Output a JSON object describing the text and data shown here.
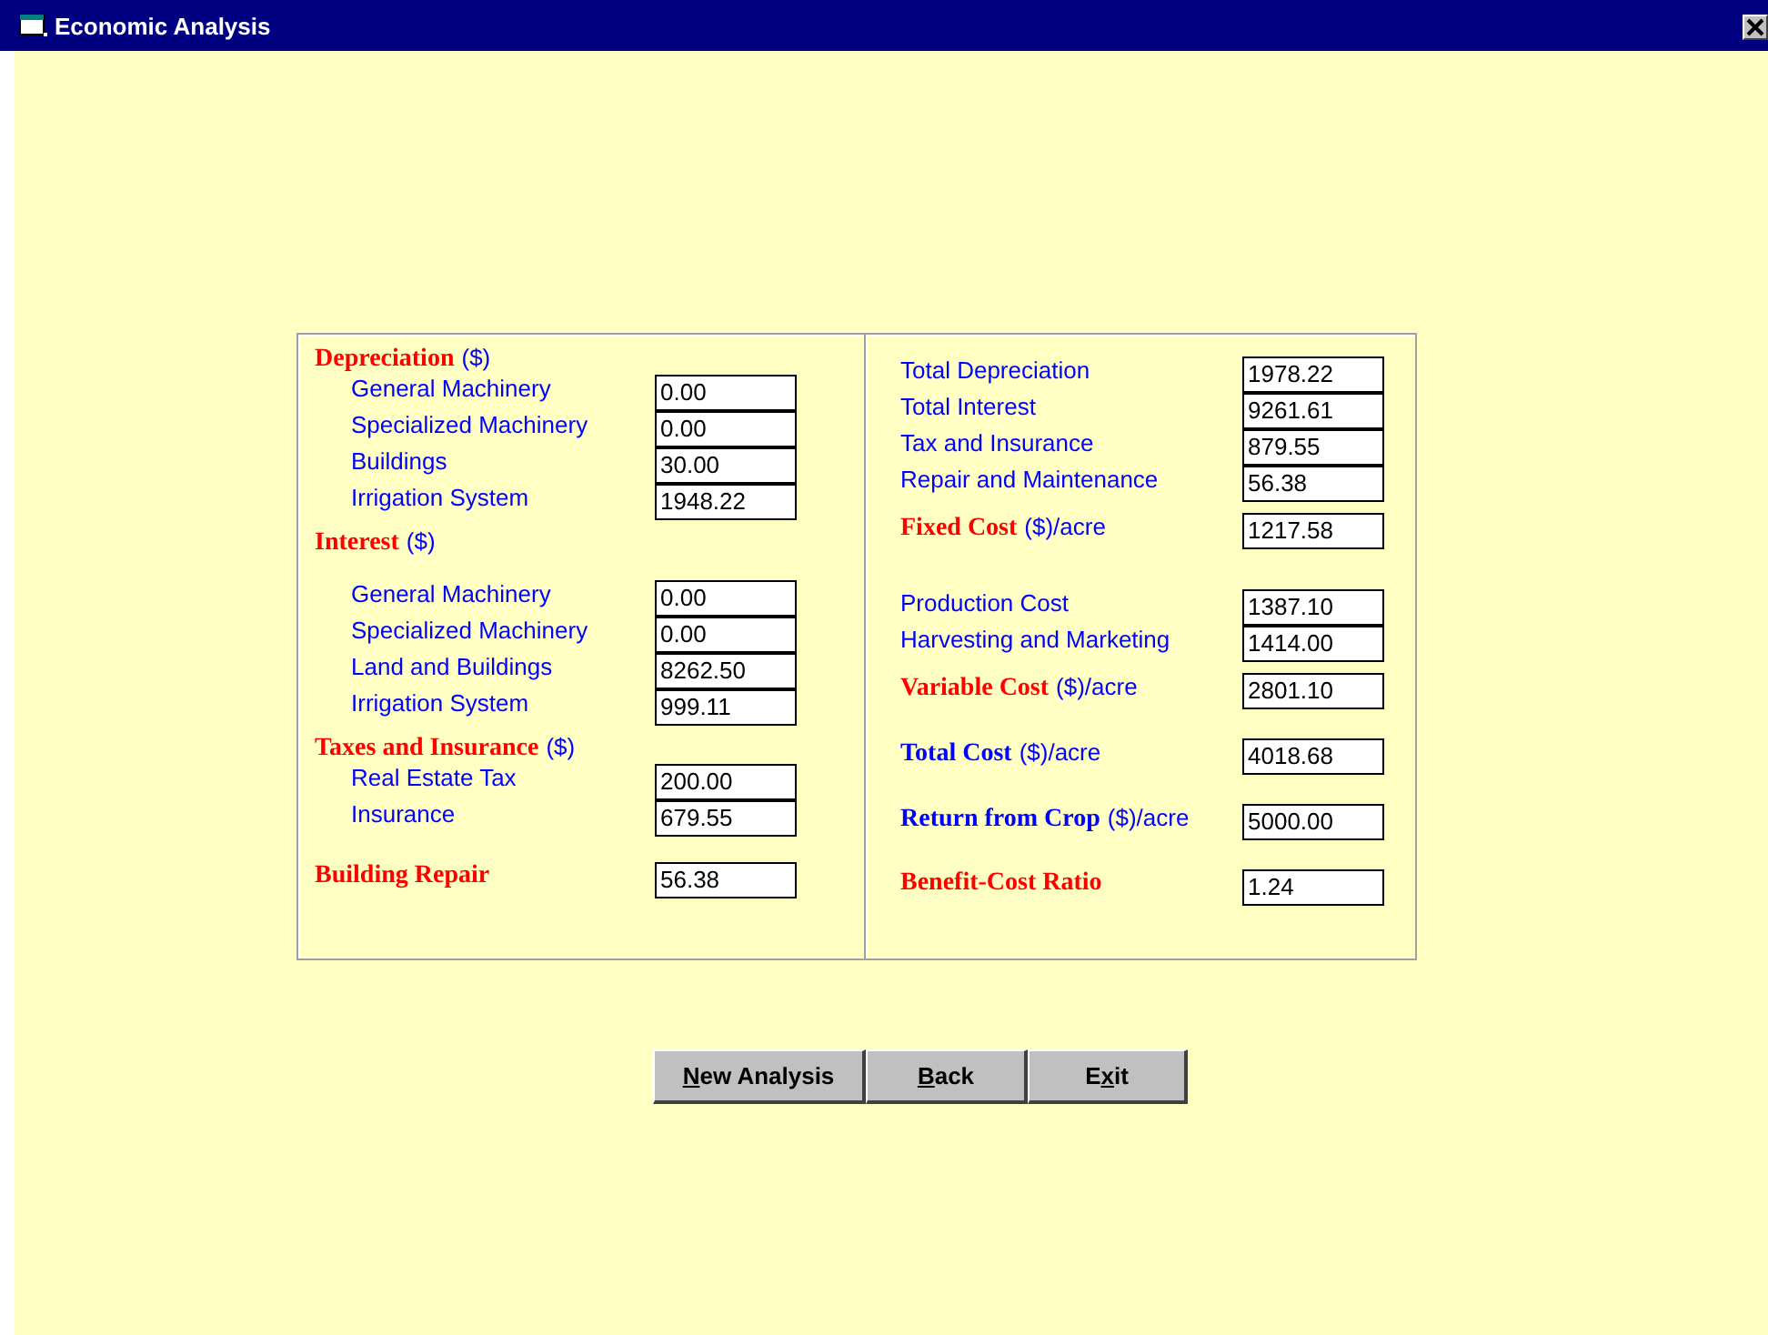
{
  "window": {
    "title": "Economic Analysis"
  },
  "left_panel": {
    "sections": [
      {
        "heading": "Depreciation",
        "unit": "($)",
        "items": [
          {
            "label": "General Machinery",
            "value": "0.00"
          },
          {
            "label": "Specialized Machinery",
            "value": "0.00"
          },
          {
            "label": "Buildings",
            "value": "30.00"
          },
          {
            "label": "Irrigation System",
            "value": "1948.22"
          }
        ]
      },
      {
        "heading": "Interest",
        "unit": "($)",
        "items": [
          {
            "label": "General Machinery",
            "value": "0.00"
          },
          {
            "label": "Specialized Machinery",
            "value": "0.00"
          },
          {
            "label": "Land and Buildings",
            "value": "8262.50"
          },
          {
            "label": "Irrigation System",
            "value": "999.11"
          }
        ]
      },
      {
        "heading": "Taxes and Insurance",
        "unit": "($)",
        "items": [
          {
            "label": "Real Estate Tax",
            "value": "200.00"
          },
          {
            "label": "Insurance",
            "value": "679.55"
          }
        ]
      },
      {
        "heading": "Building Repair",
        "value": "56.38"
      }
    ]
  },
  "right_panel": {
    "groups": [
      {
        "items": [
          {
            "label": "Total Depreciation",
            "value": "1978.22"
          },
          {
            "label": "Total Interest",
            "value": "9261.61"
          },
          {
            "label": "Tax and Insurance",
            "value": "879.55"
          },
          {
            "label": "Repair and Maintenance",
            "value": "56.38"
          }
        ],
        "total": {
          "label": "Fixed Cost",
          "unit": "($)/acre",
          "value": "1217.58",
          "color": "#ff0000"
        }
      },
      {
        "items": [
          {
            "label": "Production Cost",
            "value": "1387.10"
          },
          {
            "label": "Harvesting and Marketing",
            "value": "1414.00"
          }
        ],
        "total": {
          "label": "Variable Cost",
          "unit": "($)/acre",
          "value": "2801.10",
          "color": "#ff0000"
        }
      },
      {
        "total": {
          "label": "Total Cost",
          "unit": "($)/acre",
          "value": "4018.68",
          "color": "#0000ff"
        }
      },
      {
        "total": {
          "label": "Return from Crop",
          "unit": "($)/acre",
          "value": "5000.00",
          "color": "#0000ff"
        }
      },
      {
        "total": {
          "label": "Benefit-Cost Ratio",
          "value": "1.24",
          "color": "#ff0000"
        }
      }
    ]
  },
  "buttons": [
    {
      "mnemonic": "N",
      "after": "ew Analysis"
    },
    {
      "mnemonic": "B",
      "after": "ack"
    },
    {
      "before": "E",
      "mnemonic": "x",
      "after": "it"
    }
  ]
}
